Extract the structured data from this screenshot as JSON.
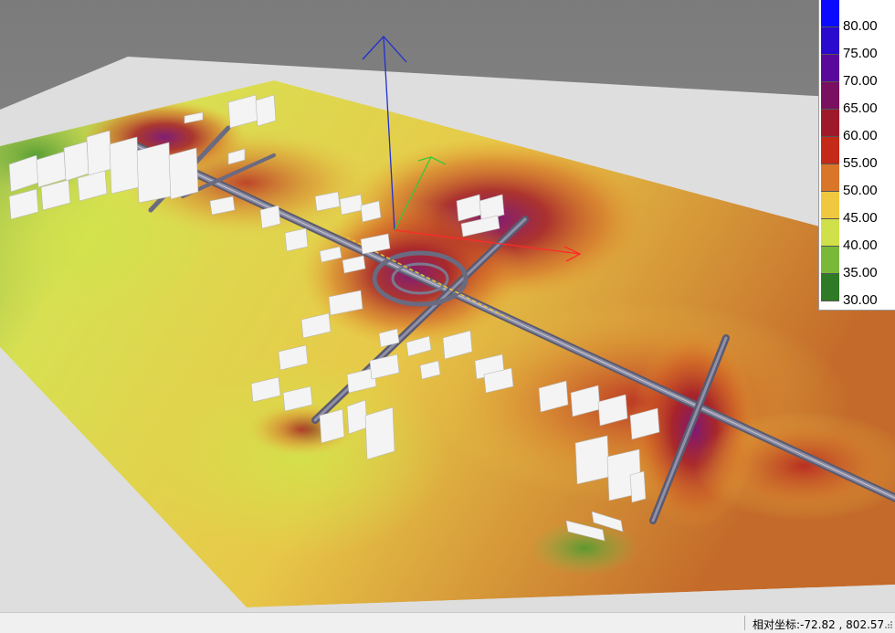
{
  "legend": {
    "entries": [
      {
        "label": "80.00",
        "color": "#0a0aff"
      },
      {
        "label": "75.00",
        "color": "#2a0acc"
      },
      {
        "label": "70.00",
        "color": "#5a0a9a"
      },
      {
        "label": "65.00",
        "color": "#7a1060"
      },
      {
        "label": "60.00",
        "color": "#9e1a2a"
      },
      {
        "label": "55.00",
        "color": "#c42a18"
      },
      {
        "label": "50.00",
        "color": "#d9762a"
      },
      {
        "label": "45.00",
        "color": "#f0c840"
      },
      {
        "label": "40.00",
        "color": "#cfe04a"
      },
      {
        "label": "35.00",
        "color": "#7ab83a"
      },
      {
        "label": "30.00",
        "color": "#2f7a26"
      }
    ]
  },
  "status_bar": {
    "coords_text": "相对坐标:-72.82 , 802.57"
  },
  "colors": {
    "sky": "#838383",
    "ground": "#dedede",
    "axis_x": "#ff2a2a",
    "axis_y": "#38c838",
    "axis_z": "#2030d0",
    "road": "#7a7a90",
    "building": "#f4f4f4"
  }
}
